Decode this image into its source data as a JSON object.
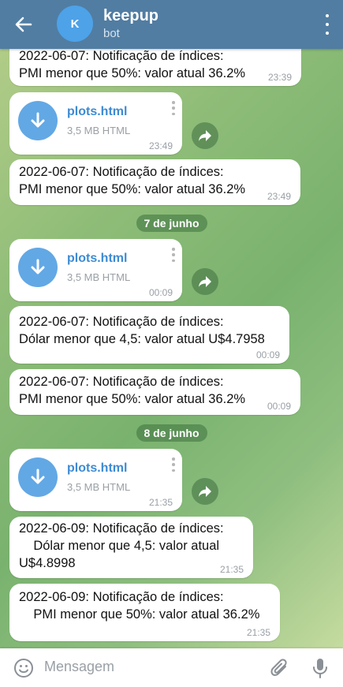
{
  "header": {
    "avatar_letter": "K",
    "title": "keepup",
    "subtitle": "bot"
  },
  "messages": [
    {
      "type": "text",
      "text": "2022-06-07: Notificação de índices:\nPMI menor que 50%: valor atual 36.2%",
      "time": "23:39"
    },
    {
      "type": "file",
      "name": "plots.html",
      "size": "3,5 MB HTML",
      "time": "23:49"
    },
    {
      "type": "text",
      "text": "2022-06-07: Notificação de índices:\nPMI menor que 50%: valor atual 36.2%",
      "time": "23:49"
    },
    {
      "type": "date",
      "text": "7 de junho"
    },
    {
      "type": "file",
      "name": "plots.html",
      "size": "3,5 MB HTML",
      "time": "00:09"
    },
    {
      "type": "text",
      "text": "2022-06-07: Notificação de índices:\nDólar menor que 4,5: valor atual U$4.7958",
      "time": "00:09"
    },
    {
      "type": "text",
      "text": "2022-06-07: Notificação de índices:\nPMI menor que 50%: valor atual 36.2%",
      "time": "00:09"
    },
    {
      "type": "date",
      "text": "8 de junho"
    },
    {
      "type": "file",
      "name": "plots.html",
      "size": "3,5 MB HTML",
      "time": "21:35"
    },
    {
      "type": "text",
      "text": "2022-06-09: Notificação de índices:\n    Dólar menor que 4,5: valor atual\nU$4.8998",
      "time": "21:35"
    },
    {
      "type": "text",
      "text": "2022-06-09: Notificação de índices:\n    PMI menor que 50%: valor atual 36.2%",
      "time": "21:35"
    }
  ],
  "input": {
    "placeholder": "Mensagem"
  }
}
